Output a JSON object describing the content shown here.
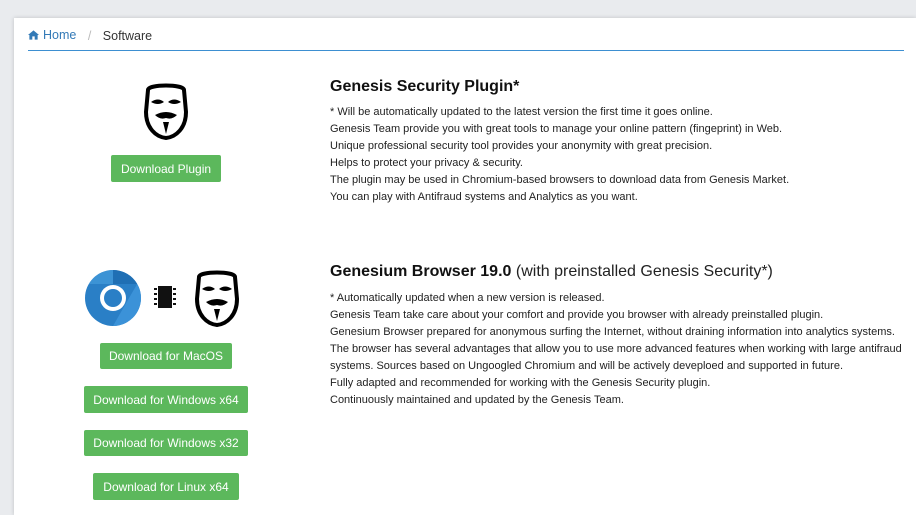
{
  "breadcrumb": {
    "home": "Home",
    "separator": "/",
    "current": "Software"
  },
  "plugin": {
    "title": "Genesis Security Plugin*",
    "download_button": "Download Plugin",
    "description": [
      "* Will be automatically updated to the latest version the first time it goes online.",
      "Genesis Team provide you with great tools to manage your online pattern (fingeprint) in Web.",
      "Unique professional security tool provides your anonymity with great precision.",
      "Helps to protect your privacy & security.",
      "The plugin may be used in Chromium-based browsers to download data from Genesis Market.",
      "You can play with Antifraud systems and Analytics as you want."
    ]
  },
  "browser": {
    "title": "Genesium Browser 19.0",
    "title_suffix": "(with preinstalled Genesis Security*)",
    "buttons": {
      "macos": "Download for MacOS",
      "win64": "Download for Windows x64",
      "win32": "Download for Windows x32",
      "linux64": "Download for Linux x64"
    },
    "description": [
      "* Automatically updated when a new version is released.",
      "Genesis Team take care about your comfort and provide you browser with already preinstalled plugin.",
      "Genesium Browser prepared for anonymous surfing the Internet, without draining information into analytics systems. The browser has several advantages that allow you to use more advanced features when working with large antifraud systems. Sources based on Ungoogled Chromium and will be actively deveploed and supported in future.",
      "Fully adapted and recommended for working with the Genesis Security plugin.",
      "Continuously maintained and updated by the Genesis Team."
    ]
  },
  "colors": {
    "button_green": "#5cb85c",
    "link_blue": "#337ab7",
    "chrome_blue": "#2a7fc6"
  }
}
